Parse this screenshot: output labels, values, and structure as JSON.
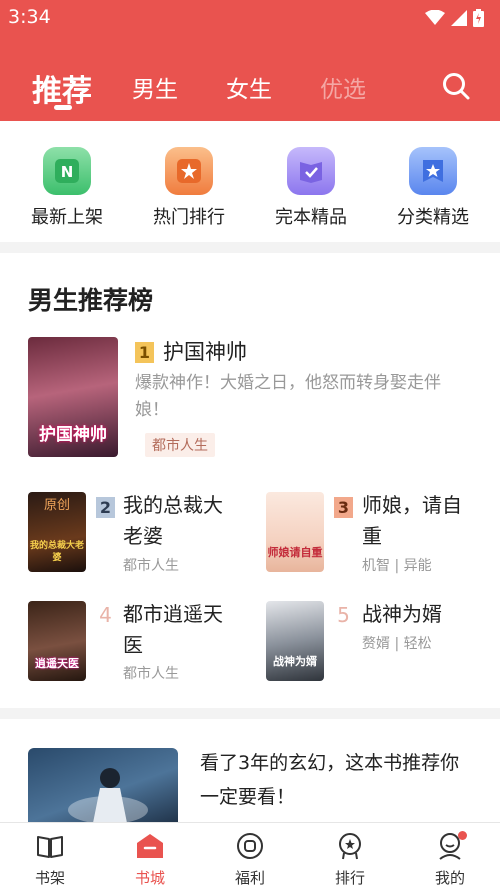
{
  "status_bar": {
    "time": "3:34"
  },
  "tabs": [
    {
      "label": "推荐",
      "active": true
    },
    {
      "label": "男生"
    },
    {
      "label": "女生"
    },
    {
      "label": "优选"
    }
  ],
  "quick_menu": [
    {
      "label": "最新上架",
      "icon": "new-shelf-icon",
      "color": "#4dc77a"
    },
    {
      "label": "热门排行",
      "icon": "hot-rank-icon",
      "color": "#f5894a"
    },
    {
      "label": "完本精品",
      "icon": "complete-book-icon",
      "color": "#9a86f2"
    },
    {
      "label": "分类精选",
      "icon": "category-icon",
      "color": "#5b8ef0"
    }
  ],
  "ranking": {
    "title": "男生推荐榜",
    "top": {
      "rank": "1",
      "title": "护国神帅",
      "desc": "爆款神作！大婚之日，他怒而转身娶走伴娘！",
      "tag": "都市人生",
      "cover_text": "护国神帅"
    },
    "items": [
      {
        "rank": "2",
        "title": "我的总裁大老婆",
        "meta": "都市人生",
        "cover_text": "我的总裁大老婆",
        "cover_top": "原创"
      },
      {
        "rank": "3",
        "title": "师娘，请自重",
        "meta": "机智 | 异能",
        "cover_text": "师娘请自重"
      },
      {
        "rank": "4",
        "title": "都市逍遥天医",
        "meta": "都市人生",
        "cover_text": "逍遥天医"
      },
      {
        "rank": "5",
        "title": "战神为婿",
        "meta": "赘婿 | 轻松",
        "cover_text": "战神为婿"
      }
    ]
  },
  "recommend": {
    "text": "看了3年的玄幻，这本书推荐你一定要看！"
  },
  "bottom_nav": [
    {
      "label": "书架",
      "icon": "bookshelf-icon"
    },
    {
      "label": "书城",
      "icon": "bookstore-icon",
      "active": true
    },
    {
      "label": "福利",
      "icon": "welfare-icon"
    },
    {
      "label": "排行",
      "icon": "ranking-icon"
    },
    {
      "label": "我的",
      "icon": "profile-icon",
      "badge": true
    }
  ],
  "colors": {
    "brand": "#e9534f"
  }
}
